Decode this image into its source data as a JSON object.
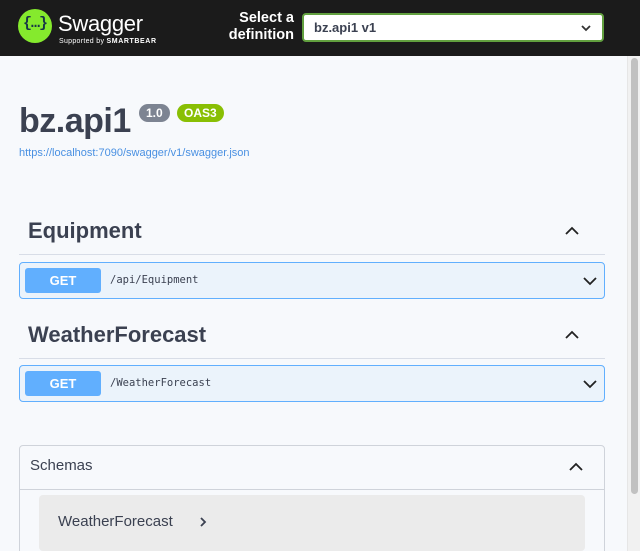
{
  "topbar": {
    "brand": "Swagger",
    "supported_by": "Supported by",
    "supported_brand": "SMARTBEAR",
    "logo_glyph": "{…}",
    "select_label_line1": "Select a",
    "select_label_line2": "definition",
    "selected_definition": "bz.api1 v1"
  },
  "info": {
    "title": "bz.api1",
    "version": "1.0",
    "oas_badge": "OAS3",
    "spec_url": "https://localhost:7090/swagger/v1/swagger.json"
  },
  "tags": [
    {
      "name": "Equipment",
      "operations": [
        {
          "method": "GET",
          "path": "/api/Equipment"
        }
      ]
    },
    {
      "name": "WeatherForecast",
      "operations": [
        {
          "method": "GET",
          "path": "/WeatherForecast"
        }
      ]
    }
  ],
  "schemas": {
    "label": "Schemas",
    "models": [
      "WeatherForecast"
    ]
  },
  "colors": {
    "topbar_bg": "#1b1b1b",
    "logo_green": "#85ea2d",
    "get_blue": "#61affe",
    "op_bg": "#ebf3fb",
    "version_badge": "#7d8492",
    "oas_badge": "#89bf04",
    "select_border": "#62a03f"
  },
  "icons": {
    "tag_toggle": "chevron-up-icon",
    "op_toggle": "chevron-down-icon",
    "model_expand": "chevron-right-icon"
  }
}
